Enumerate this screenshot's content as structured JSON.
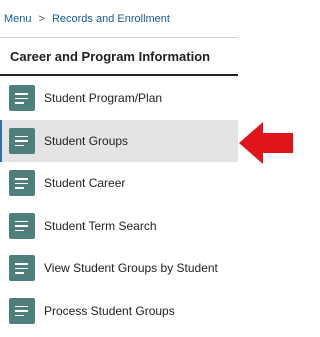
{
  "breadcrumb": {
    "home": "Menu",
    "separator": ">",
    "current": "Records and Enrollment"
  },
  "section": {
    "title": "Career and Program Information"
  },
  "nav_items": [
    {
      "label": "Student Program/Plan",
      "icon": "document-icon",
      "selected": false
    },
    {
      "label": "Student Groups",
      "icon": "document-icon",
      "selected": true
    },
    {
      "label": "Student Career",
      "icon": "document-icon",
      "selected": false
    },
    {
      "label": "Student Term Search",
      "icon": "document-icon",
      "selected": false
    },
    {
      "label": "View Student Groups by Student",
      "icon": "document-icon",
      "selected": false
    },
    {
      "label": "Process Student Groups",
      "icon": "document-icon",
      "selected": false
    }
  ],
  "colors": {
    "icon_bg": "#4f7f7c",
    "link": "#1a5a9c",
    "selected_bg": "#e4e4e4",
    "selected_bar": "#2d6db0",
    "arrow": "#e0141b"
  },
  "annotation": {
    "icon": "red-arrow-icon",
    "points_to": "Student Groups"
  }
}
